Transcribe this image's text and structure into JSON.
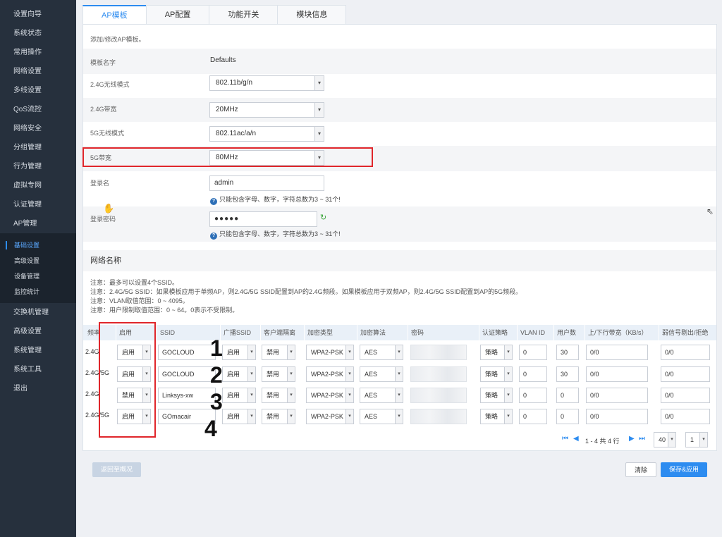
{
  "sidebar": {
    "items_top": [
      "设置向导",
      "系统状态",
      "常用操作",
      "网络设置",
      "多线设置",
      "QoS流控",
      "网络安全",
      "分组管理",
      "行为管理",
      "虚拟专网",
      "认证管理",
      "AP管理"
    ],
    "sub_items": [
      "基础设置",
      "高级设置",
      "设备管理",
      "监控统计"
    ],
    "items_bottom": [
      "交换机管理",
      "高级设置",
      "系统管理",
      "系统工具",
      "退出"
    ]
  },
  "tabs": [
    "AP模板",
    "AP配置",
    "功能开关",
    "模块信息"
  ],
  "form": {
    "hint": "添加/修改AP模板。",
    "template_name_label": "模板名字",
    "template_name_value": "Defaults",
    "mode24_label": "2.4G无线模式",
    "mode24_value": "802.11b/g/n",
    "bw24_label": "2.4G带宽",
    "bw24_value": "20MHz",
    "mode5_label": "5G无线模式",
    "mode5_value": "802.11ac/a/n",
    "bw5_label": "5G带宽",
    "bw5_value": "80MHz",
    "login_label": "登录名",
    "login_value": "admin",
    "login_note": "只能包含字母、数字，字符总数为3 ~ 31个!",
    "password_label": "登录密码",
    "password_value": "●●●●●",
    "password_note": "只能包含字母、数字，字符总数为3 ~ 31个!"
  },
  "network": {
    "title": "网络名称",
    "notes": [
      "注意：最多可以设置4个SSID。",
      "注意：2.4G/5G SSID：如果模板应用于单频AP，则2.4G/5G SSID配置到AP的2.4G频段。如果模板应用于双频AP，则2.4G/5G SSID配置到AP的5G频段。",
      "注意：VLAN取值范围：0 ~ 4095。",
      "注意：用户限制取值范围：0 ~ 64。0表示不受限制。"
    ],
    "columns": [
      "频率",
      "启用",
      "SSID",
      "广播SSID",
      "客户端隔离",
      "加密类型",
      "加密算法",
      "密码",
      "认证策略",
      "VLAN ID",
      "用户数",
      "上/下行带宽（KB/s）",
      "弱信号剔出/拒绝"
    ],
    "rows": [
      {
        "freq": "2.4G",
        "enable": "启用",
        "ssid": "GOCLOUD",
        "broadcast": "启用",
        "isolation": "禁用",
        "enc_type": "WPA2-PSK",
        "enc_alg": "AES",
        "auth": "策略",
        "vlan": "0",
        "users": "30",
        "bandwidth": "0/0",
        "weak": "0/0"
      },
      {
        "freq": "2.4G/5G",
        "enable": "启用",
        "ssid": "GOCLOUD",
        "broadcast": "启用",
        "isolation": "禁用",
        "enc_type": "WPA2-PSK",
        "enc_alg": "AES",
        "auth": "策略",
        "vlan": "0",
        "users": "30",
        "bandwidth": "0/0",
        "weak": "0/0"
      },
      {
        "freq": "2.4G",
        "enable": "禁用",
        "ssid": "Linksys-xw",
        "broadcast": "启用",
        "isolation": "禁用",
        "enc_type": "WPA2-PSK",
        "enc_alg": "AES",
        "auth": "策略",
        "vlan": "0",
        "users": "0",
        "bandwidth": "0/0",
        "weak": "0/0"
      },
      {
        "freq": "2.4G/5G",
        "enable": "启用",
        "ssid": "GOmacair",
        "broadcast": "启用",
        "isolation": "禁用",
        "enc_type": "WPA2-PSK",
        "enc_alg": "AES",
        "auth": "策略",
        "vlan": "0",
        "users": "0",
        "bandwidth": "0/0",
        "weak": "0/0"
      }
    ],
    "annotations": [
      "1",
      "2",
      "3",
      "4"
    ]
  },
  "pager": {
    "summary": "1 - 4 共 4 行",
    "page_size": "40",
    "page": "1"
  },
  "footer": {
    "back": "返回至概况",
    "clear": "清除",
    "save": "保存&应用"
  }
}
